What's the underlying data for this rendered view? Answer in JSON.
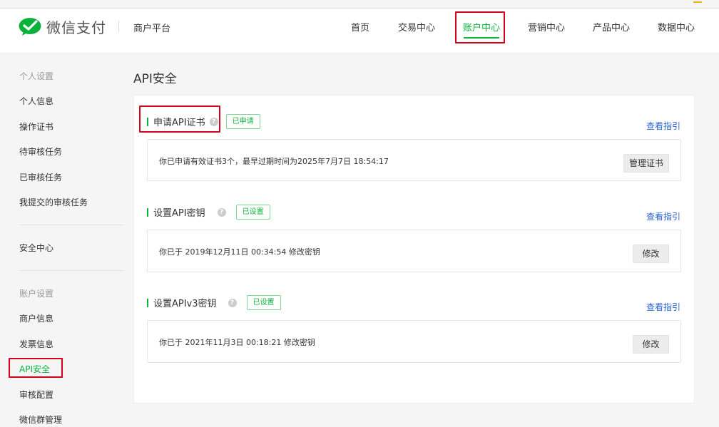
{
  "brand": {
    "logo_text": "微信支付",
    "platform": "商户平台",
    "brand_color": "#09b23a"
  },
  "nav": {
    "items": [
      {
        "label": "首页"
      },
      {
        "label": "交易中心"
      },
      {
        "label": "账户中心",
        "active": true
      },
      {
        "label": "营销中心"
      },
      {
        "label": "产品中心"
      },
      {
        "label": "数据中心"
      }
    ]
  },
  "sidebar": {
    "group1_title": "个人设置",
    "group1_items": [
      "个人信息",
      "操作证书",
      "待审核任务",
      "已审核任务",
      "我提交的审核任务"
    ],
    "group2_items": [
      "安全中心"
    ],
    "group3_title": "账户设置",
    "group3_items": [
      "商户信息",
      "发票信息",
      "API安全",
      "审核配置",
      "微信群管理"
    ],
    "active_item": "API安全"
  },
  "page": {
    "title": "API安全",
    "guide_label": "查看指引",
    "help_icon": "?"
  },
  "sections": [
    {
      "title": "申请API证书",
      "badge": "已申请",
      "text": "你已申请有效证书3个，最早过期时间为2025年7月7日 18:54:17",
      "button": "管理证书"
    },
    {
      "title": "设置API密钥",
      "badge": "已设置",
      "text": "你已于 2019年12月11日 00:34:54 修改密钥",
      "button": "修改"
    },
    {
      "title": "设置APIv3密钥",
      "badge": "已设置",
      "text": "你已于 2021年11月3日 00:18:21 修改密钥",
      "button": "修改"
    }
  ],
  "colors": {
    "highlight_box": "#d9001b",
    "link": "#2b63c9"
  }
}
